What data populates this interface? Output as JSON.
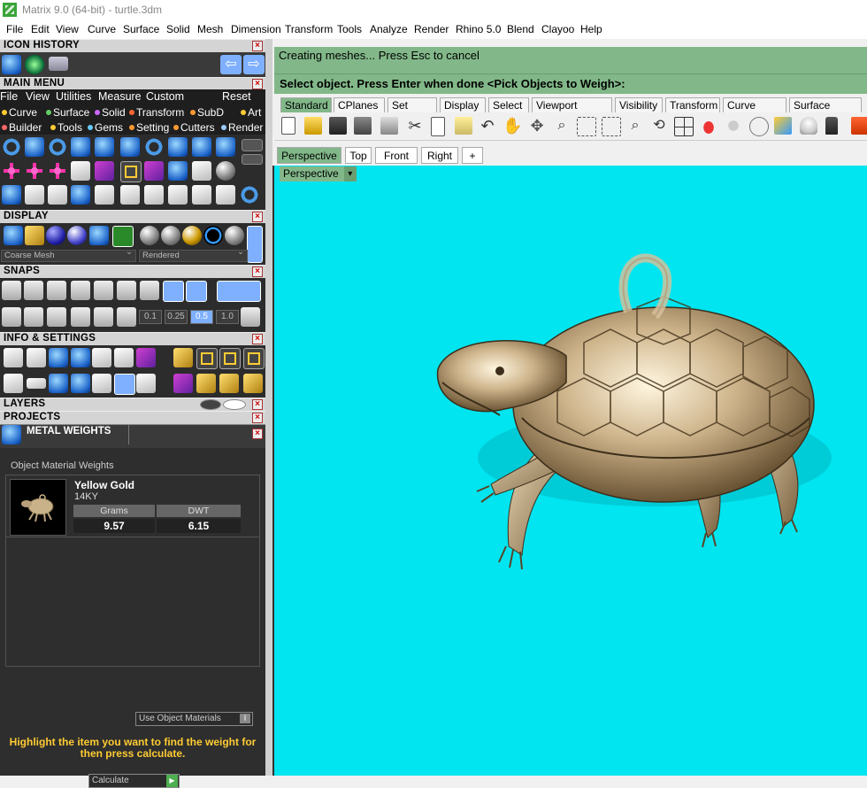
{
  "window": {
    "title": "Matrix 9.0 (64-bit) - turtle.3dm"
  },
  "menubar": [
    "File",
    "Edit",
    "View",
    "Curve",
    "Surface",
    "Solid",
    "Mesh",
    "Dimension",
    "Transform",
    "Tools",
    "Analyze",
    "Render",
    "Rhino 5.0",
    "Blend",
    "Clayoo",
    "Help"
  ],
  "panel": {
    "icon_history": "ICON HISTORY",
    "main_menu": "MAIN MENU",
    "main_menu_items": [
      "File",
      "View",
      "Utilities",
      "Measure",
      "Custom"
    ],
    "reset": "Reset",
    "categories_row1": [
      "Curve",
      "Surface",
      "Solid",
      "Transform",
      "SubD",
      "Art"
    ],
    "categories_row2": [
      "Builder",
      "Tools",
      "Gems",
      "Setting",
      "Cutters",
      "Render"
    ],
    "display": "DISPLAY",
    "display_mesh": "Coarse Mesh",
    "display_mode": "Rendered",
    "snaps": "SNAPS",
    "snap_values": [
      "0.1",
      "0.25",
      "0.5",
      "1.0"
    ],
    "info_settings": "INFO & SETTINGS",
    "layers": "LAYERS",
    "projects": "PROJECTS",
    "metal_weights": "METAL WEIGHTS"
  },
  "metal": {
    "subtitle": "Object Material Weights",
    "material": "Yellow Gold",
    "karat": "14KY",
    "col_grams": "Grams",
    "col_dwt": "DWT",
    "grams": "9.57",
    "dwt": "6.15",
    "use_materials": "Use Object Materials",
    "hint": "Highlight the item you want to find the weight for then press calculate.",
    "calculate": "Calculate"
  },
  "command": {
    "line1": "Creating meshes... Press Esc to cancel",
    "prompt": "Select object. Press Enter when done <Pick Objects to Weigh>:"
  },
  "toolbar_tabs": [
    "Standard",
    "CPlanes",
    "Set View",
    "Display",
    "Select",
    "Viewport Layout",
    "Visibility",
    "Transform",
    "Curve Tools",
    "Surface Tools"
  ],
  "view_tabs": [
    "Perspective",
    "Top",
    "Front",
    "Right"
  ],
  "view_add": "+",
  "viewport_label": "Perspective",
  "colors": {
    "accent": "#82b889",
    "viewport_bg": "#00e5f0",
    "panel_bg": "#2c2c2c",
    "hint": "#ffcc33"
  }
}
